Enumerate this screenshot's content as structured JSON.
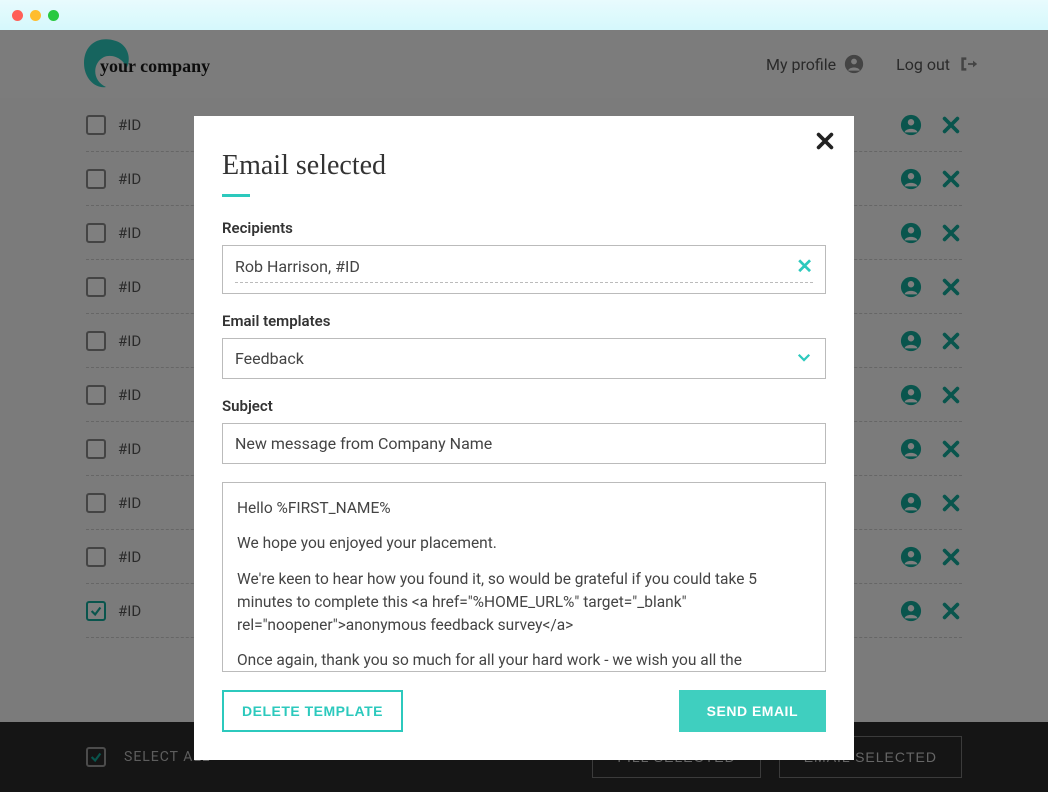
{
  "header": {
    "logo_text": "your company",
    "profile_link": "My profile",
    "logout_link": "Log out"
  },
  "rows": [
    {
      "id": "#ID",
      "checked": false
    },
    {
      "id": "#ID",
      "checked": false
    },
    {
      "id": "#ID",
      "checked": false
    },
    {
      "id": "#ID",
      "checked": false
    },
    {
      "id": "#ID",
      "checked": false
    },
    {
      "id": "#ID",
      "checked": false
    },
    {
      "id": "#ID",
      "checked": false
    },
    {
      "id": "#ID",
      "checked": false
    },
    {
      "id": "#ID",
      "checked": false
    },
    {
      "id": "#ID",
      "checked": true
    }
  ],
  "bottom": {
    "select_all": "SELECT ALL",
    "select_all_checked": true,
    "fill_selected": "FILL SELECTED",
    "email_selected": "EMAIL SELECTED"
  },
  "modal": {
    "title": "Email selected",
    "recipients_label": "Recipients",
    "recipient_value": "Rob Harrison, #ID",
    "templates_label": "Email templates",
    "template_value": "Feedback",
    "subject_label": "Subject",
    "subject_value": "New message from Company Name",
    "body_p1": "Hello %FIRST_NAME%",
    "body_p2": "We hope you enjoyed your placement.",
    "body_p3": "We're keen to hear how you found it, so would be grateful if you could take 5 minutes to complete this <a href=\"%HOME_URL%\" target=\"_blank\" rel=\"noopener\">anonymous feedback survey</a>",
    "body_p4": "Once again, thank you so much for all your hard work - we wish you all the",
    "delete_template": "DELETE TEMPLATE",
    "send_email": "SEND EMAIL"
  }
}
